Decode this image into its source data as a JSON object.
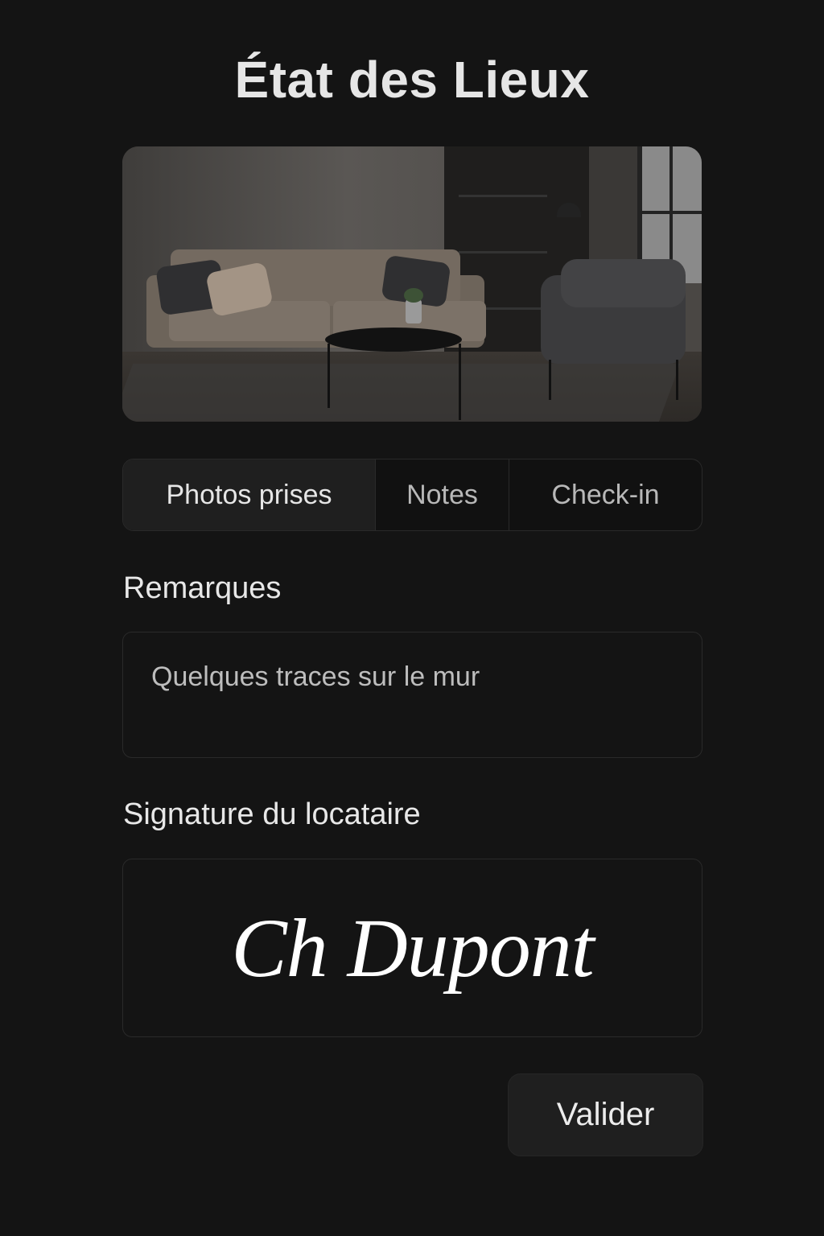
{
  "header": {
    "title": "État des Lieux"
  },
  "photo": {
    "subject": "living-room-photo"
  },
  "tabs": [
    {
      "label": "Photos prises",
      "active": true
    },
    {
      "label": "Notes",
      "active": false
    },
    {
      "label": "Check-in",
      "active": false
    }
  ],
  "remarks": {
    "label": "Remarques",
    "value": "Quelques traces sur le mur"
  },
  "signature": {
    "label": "Signature du locataire",
    "signed_text": "Ch Dupont"
  },
  "actions": {
    "validate_label": "Valider"
  },
  "colors": {
    "background": "#141414",
    "surface": "#1f1f1f",
    "border": "#2a2a2a",
    "text": "#e8e8e8"
  }
}
